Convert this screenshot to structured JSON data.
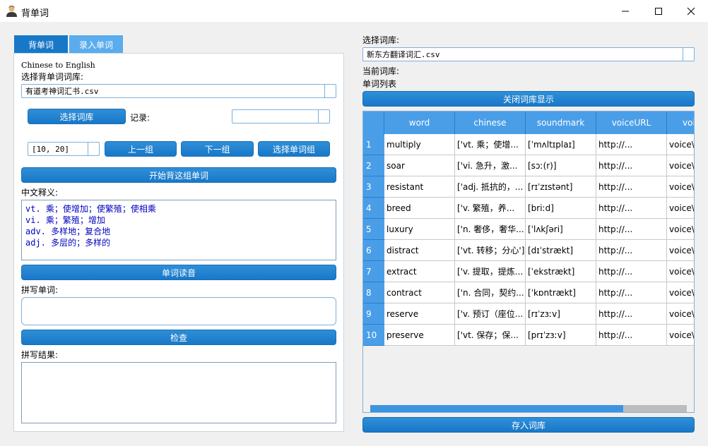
{
  "window": {
    "title": "背单词"
  },
  "tabs": [
    {
      "label": "背单词"
    },
    {
      "label": "录入单词"
    }
  ],
  "left": {
    "mode_text": "Chinese to English",
    "select_lib_label": "选择背单词词库:",
    "lib_value": "有道考神词汇书.csv",
    "select_lib_button": "选择词库",
    "record_label": "记录:",
    "record_value": "",
    "group_value": "[10, 20]",
    "prev_button": "上一组",
    "next_button": "下一组",
    "choose_group_button": "选择单词组",
    "start_button": "开始背这组单词",
    "meaning_label": "中文释义:",
    "meaning_lines": [
      "vt. 乘；使增加；使繁殖；使相乘",
      "vi. 乘；繁殖；增加",
      "adv. 多样地；复合地",
      "adj. 多层的；多样的"
    ],
    "read_button": "单词读音",
    "spell_label": "拼写单词:",
    "spell_value": "",
    "check_button": "检查",
    "result_label": "拼写结果:",
    "result_value": ""
  },
  "right": {
    "select_lib_label": "选择词库:",
    "lib_value": "新东方翻译词汇.csv",
    "current_lib_label": "当前词库:",
    "current_lib_value": "",
    "word_list_label": "单词列表",
    "close_button": "关闭词库显示",
    "save_button": "存入词库",
    "table": {
      "columns": [
        "word",
        "chinese",
        "soundmark",
        "voiceURL",
        "voi"
      ],
      "rows": [
        {
          "n": "1",
          "word": "multiply",
          "chinese": "['vt. 乘；使增...",
          "soundmark": "[ˈmʌltɪplaɪ]",
          "voiceURL": "http://...",
          "voice": "voice\\"
        },
        {
          "n": "2",
          "word": "soar",
          "chinese": "['vi. 急升，激...",
          "soundmark": "[sɔː(r)]",
          "voiceURL": "http://...",
          "voice": "voice\\"
        },
        {
          "n": "3",
          "word": "resistant",
          "chinese": "['adj. 抵抗的，...",
          "soundmark": "[rɪˈzɪstənt]",
          "voiceURL": "http://...",
          "voice": "voice\\"
        },
        {
          "n": "4",
          "word": "breed",
          "chinese": "['v. 繁殖，养...",
          "soundmark": "[briːd]",
          "voiceURL": "http://...",
          "voice": "voice\\"
        },
        {
          "n": "5",
          "word": "luxury",
          "chinese": "['n. 奢侈，奢华...",
          "soundmark": "[ˈlʌkʃəri]",
          "voiceURL": "http://...",
          "voice": "voice\\"
        },
        {
          "n": "6",
          "word": "distract",
          "chinese": "['vt. 转移；分心']",
          "soundmark": "[dɪˈstrækt]",
          "voiceURL": "http://...",
          "voice": "voice\\"
        },
        {
          "n": "7",
          "word": "extract",
          "chinese": "['v. 提取，提炼...",
          "soundmark": "[ˈekstrækt]",
          "voiceURL": "http://...",
          "voice": "voice\\"
        },
        {
          "n": "8",
          "word": "contract",
          "chinese": "['n. 合同，契约...",
          "soundmark": "[ˈkɒntrækt]",
          "voiceURL": "http://...",
          "voice": "voice\\"
        },
        {
          "n": "9",
          "word": "reserve",
          "chinese": "['v. 预订（座位...",
          "soundmark": "[rɪˈzɜːv]",
          "voiceURL": "http://...",
          "voice": "voice\\"
        },
        {
          "n": "10",
          "word": "preserve",
          "chinese": "['vt. 保存；保...",
          "soundmark": "[prɪˈzɜːv]",
          "voiceURL": "http://...",
          "voice": "voice\\"
        }
      ]
    }
  },
  "colors": {
    "accent": "#1878c8",
    "header": "#4a9ee8",
    "tab_inactive": "#5aacec",
    "meaning_text": "#0000c0"
  }
}
